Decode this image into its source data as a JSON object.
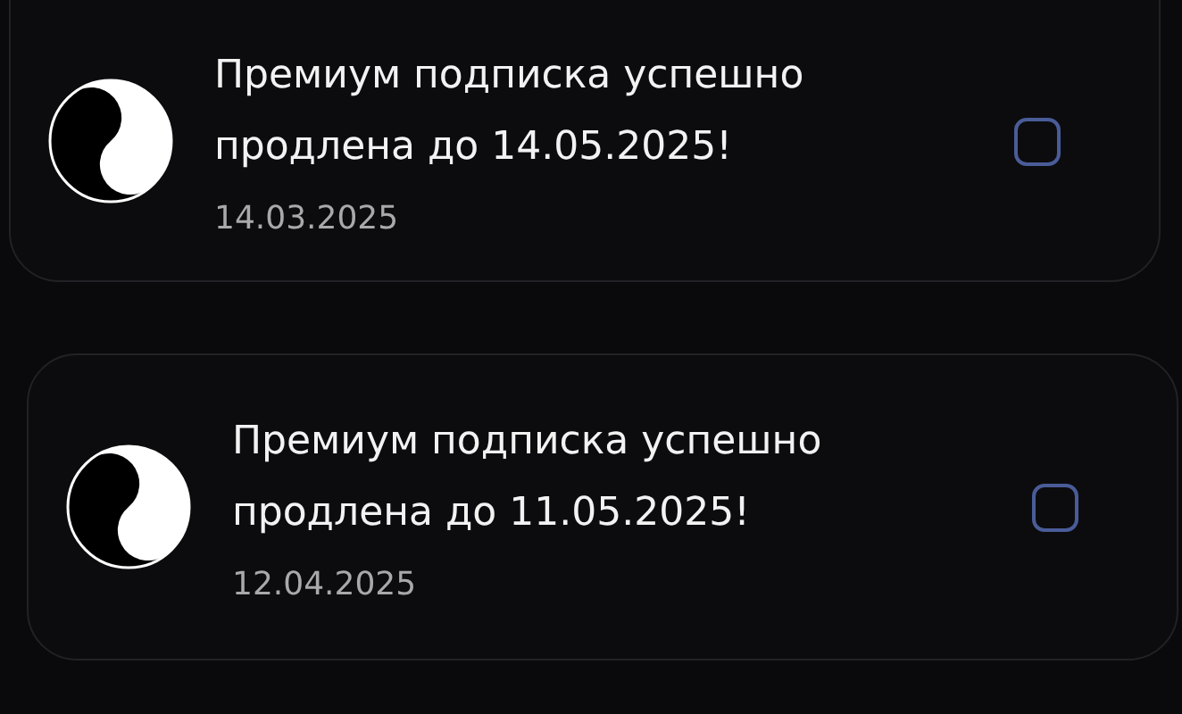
{
  "notifications": [
    {
      "message": "Премиум подписка успешно продлена до 14.05.2025!",
      "date": "14.03.2025",
      "checked": false
    },
    {
      "message": "Премиум подписка успешно продлена до 11.05.2025!",
      "date": "12.04.2025",
      "checked": false
    }
  ]
}
